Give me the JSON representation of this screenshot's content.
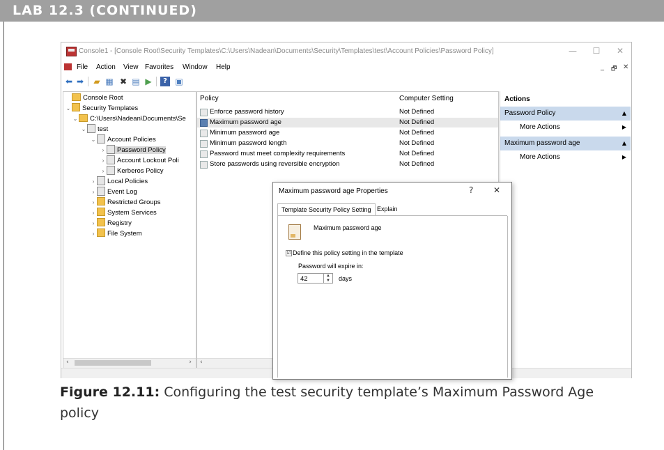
{
  "banner": {
    "label": "LAB 12.3 (CONTINUED)"
  },
  "window": {
    "title": "Console1 - [Console Root\\Security Templates\\C:\\Users\\Nadean\\Documents\\Security\\Templates\\test\\Account Policies\\Password Policy]",
    "controls": {
      "minimize": "—",
      "maximize": "☐",
      "close": "✕"
    },
    "mdi_controls": {
      "minimize": "_",
      "restore": "🗗",
      "close": "✕"
    }
  },
  "menu": {
    "items": [
      "File",
      "Action",
      "View",
      "Favorites",
      "Window",
      "Help"
    ]
  },
  "toolbar": {
    "icons": [
      "back-arrow-icon",
      "forward-arrow-icon",
      "up-folder-icon",
      "show-tree-icon",
      "delete-icon",
      "properties-icon",
      "export-icon",
      "help-icon",
      "console-icon"
    ]
  },
  "tree": {
    "items": [
      {
        "label": "Console Root",
        "twist": "",
        "icon": "folder"
      },
      {
        "label": "Security Templates",
        "twist": "⌄",
        "icon": "sec"
      },
      {
        "label": "C:\\Users\\Nadean\\Documents\\Se",
        "twist": "⌄",
        "icon": "folder"
      },
      {
        "label": "test",
        "twist": "⌄",
        "icon": "doc"
      },
      {
        "label": "Account Policies",
        "twist": "⌄",
        "icon": "doc"
      },
      {
        "label": "Password Policy",
        "twist": "›",
        "icon": "doc"
      },
      {
        "label": "Account Lockout Poli",
        "twist": "›",
        "icon": "doc"
      },
      {
        "label": "Kerberos Policy",
        "twist": "›",
        "icon": "doc"
      },
      {
        "label": "Local Policies",
        "twist": "›",
        "icon": "doc"
      },
      {
        "label": "Event Log",
        "twist": "›",
        "icon": "doc"
      },
      {
        "label": "Restricted Groups",
        "twist": "›",
        "icon": "sec"
      },
      {
        "label": "System Services",
        "twist": "›",
        "icon": "sec"
      },
      {
        "label": "Registry",
        "twist": "›",
        "icon": "sec"
      },
      {
        "label": "File System",
        "twist": "›",
        "icon": "sec"
      }
    ],
    "scroll_left": "‹",
    "scroll_right": "›"
  },
  "list": {
    "col_policy": "Policy",
    "col_setting": "Computer Setting",
    "rows": [
      {
        "policy": "Enforce password history",
        "setting": "Not Defined"
      },
      {
        "policy": "Maximum password age",
        "setting": "Not Defined"
      },
      {
        "policy": "Minimum password age",
        "setting": "Not Defined"
      },
      {
        "policy": "Minimum password length",
        "setting": "Not Defined"
      },
      {
        "policy": "Password must meet complexity requirements",
        "setting": "Not Defined"
      },
      {
        "policy": "Store passwords using reversible encryption",
        "setting": "Not Defined"
      }
    ],
    "scroll_left": "‹"
  },
  "actions": {
    "title": "Actions",
    "section1": "Password Policy",
    "section1_more": "More Actions",
    "section2": "Maximum password age",
    "section2_more": "More Actions",
    "collapse_glyph": "▲",
    "more_glyph": "▶"
  },
  "dialog": {
    "title": "Maximum password age Properties",
    "help": "?",
    "close": "✕",
    "tab1": "Template Security Policy Setting",
    "tab2": "Explain",
    "policy_name": "Maximum password age",
    "checkbox_mark": "☑",
    "checkbox_label": "Define this policy setting in the template",
    "expire_label": "Password will expire in:",
    "value": "42",
    "unit": "days",
    "spin_up": "▲",
    "spin_down": "▼"
  },
  "caption": {
    "label": "Figure 12.11:",
    "text": "Configuring the test security template’s Maximum Password Age policy"
  }
}
